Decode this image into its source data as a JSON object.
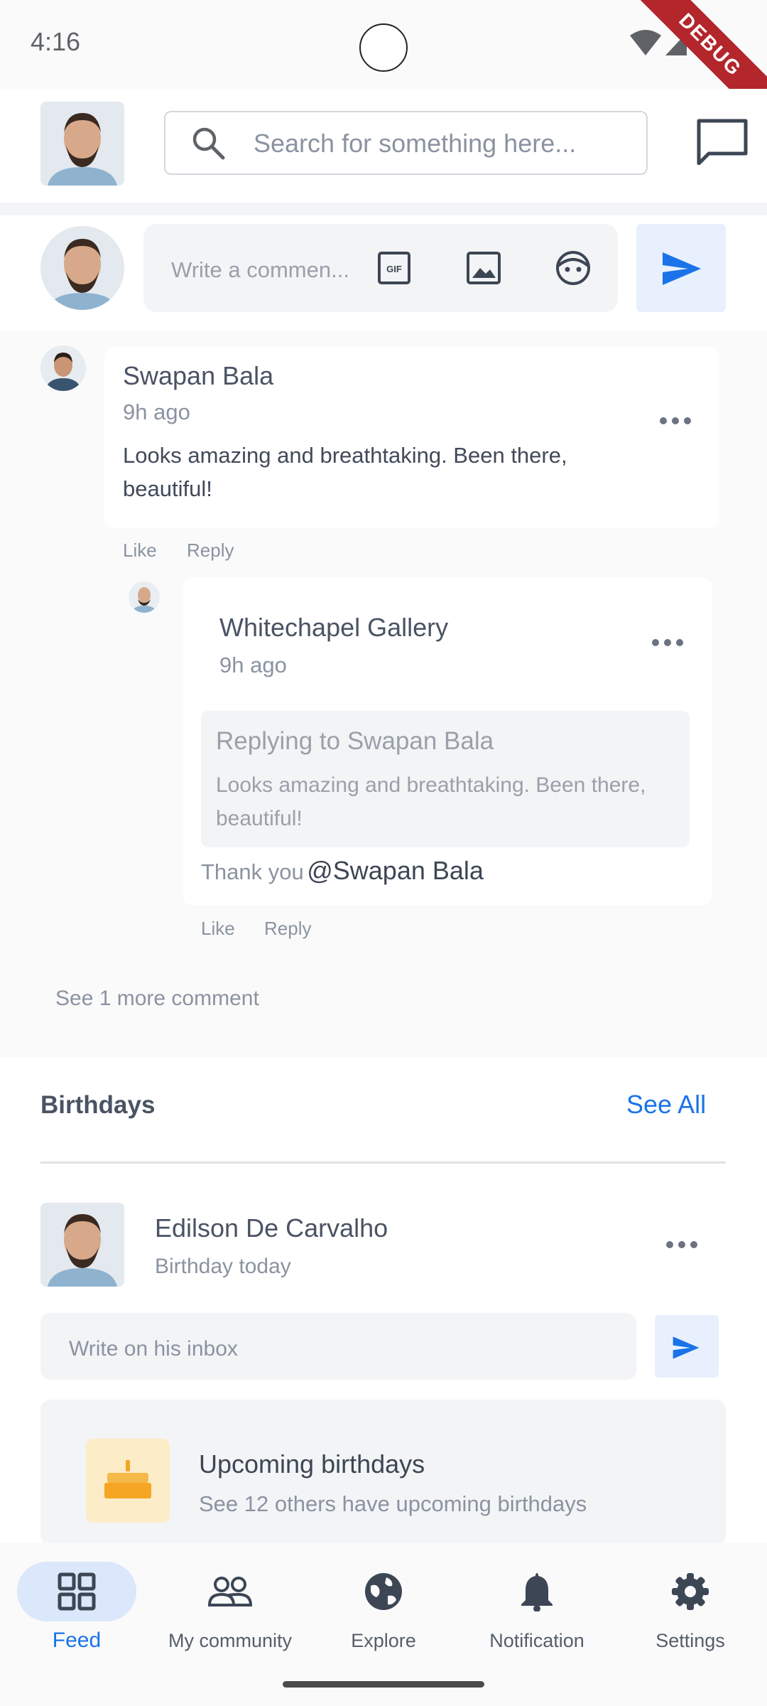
{
  "status_bar": {
    "time": "4:16",
    "debug_label": "DEBUG"
  },
  "header": {
    "search_placeholder": "Search for something here..."
  },
  "composer": {
    "placeholder": "Write a commen..."
  },
  "comments": [
    {
      "author": "Swapan Bala",
      "time": "9h ago",
      "text": "Looks amazing and breathtaking. Been there, beautiful!",
      "like_label": "Like",
      "reply_label": "Reply"
    }
  ],
  "reply": {
    "author": "Whitechapel Gallery",
    "time": "9h ago",
    "quote_title": "Replying to Swapan Bala",
    "quote_text": "Looks amazing and breathtaking. Been there, beautiful!",
    "text_prefix": "Thank you",
    "mention": "@Swapan Bala",
    "like_label": "Like",
    "reply_label": "Reply"
  },
  "see_more": "See 1 more comment",
  "birthdays": {
    "title": "Birthdays",
    "see_all": "See All",
    "person_name": "Edilson De Carvalho",
    "person_status": "Birthday today",
    "inbox_placeholder": "Write on his inbox",
    "upcoming_title": "Upcoming birthdays",
    "upcoming_subtitle": "See 12 others have upcoming birthdays"
  },
  "nav": [
    {
      "label": "Feed",
      "icon": "grid-icon",
      "active": true
    },
    {
      "label": "My community",
      "icon": "people-icon",
      "active": false
    },
    {
      "label": "Explore",
      "icon": "globe-icon",
      "active": false
    },
    {
      "label": "Notification",
      "icon": "bell-icon",
      "active": false
    },
    {
      "label": "Settings",
      "icon": "gear-icon",
      "active": false
    }
  ],
  "colors": {
    "accent": "#1a73e8",
    "accent_light": "#e8f0fe",
    "nav_active_bg": "#dbe7fb"
  }
}
